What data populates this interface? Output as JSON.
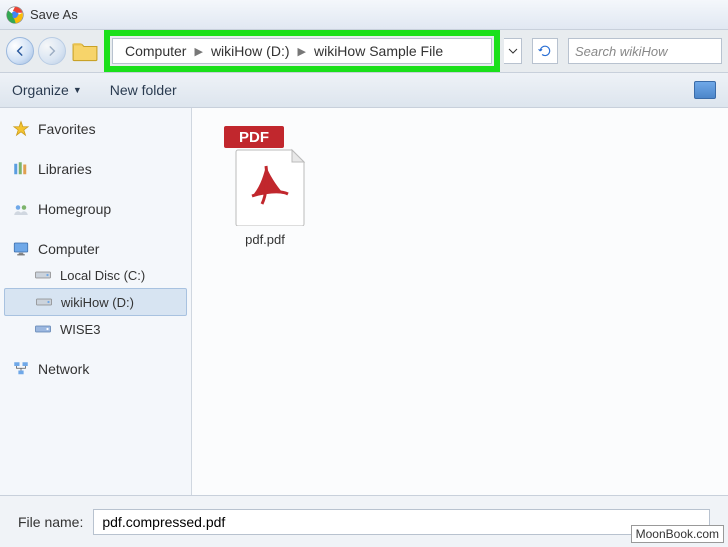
{
  "window": {
    "title": "Save As"
  },
  "breadcrumb": {
    "seg1": "Computer",
    "seg2": "wikiHow (D:)",
    "seg3": "wikiHow Sample File"
  },
  "search": {
    "placeholder": "Search wikiHow"
  },
  "toolbar": {
    "organize": "Organize",
    "newfolder": "New folder"
  },
  "sidebar": {
    "favorites": "Favorites",
    "libraries": "Libraries",
    "homegroup": "Homegroup",
    "computer": "Computer",
    "localdisc": "Local Disc (C:)",
    "wikihow": "wikiHow (D:)",
    "wise3": "WISE3",
    "network": "Network"
  },
  "content": {
    "file1": "pdf.pdf",
    "pdf_badge": "PDF"
  },
  "bottom": {
    "filename_label": "File name:",
    "filename_value": "pdf.compressed.pdf"
  },
  "watermark": "MoonBook.com"
}
